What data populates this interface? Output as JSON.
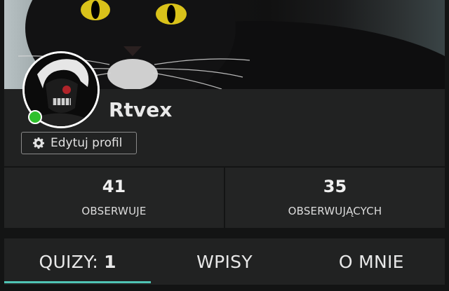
{
  "profile": {
    "username": "Rtvex",
    "edit_label": "Edytuj profil",
    "status": "online"
  },
  "stats": [
    {
      "value": "41",
      "label": "OBSERWUJE"
    },
    {
      "value": "35",
      "label": "OBSERWUJĄCYCH"
    }
  ],
  "tabs": [
    {
      "label": "QUIZY:",
      "count": "1",
      "active": true
    },
    {
      "label": "WPISY",
      "count": "",
      "active": false
    },
    {
      "label": "O MNIE",
      "count": "",
      "active": false
    }
  ],
  "colors": {
    "accent": "#4fc4b4",
    "online": "#2fc02c",
    "background": "#131414",
    "panel": "#212222"
  },
  "icons": {
    "edit": "gear-icon"
  }
}
